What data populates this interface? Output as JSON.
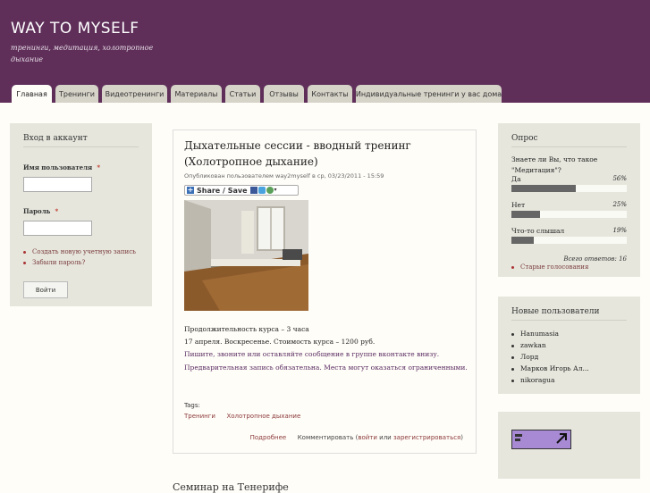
{
  "site": {
    "name": "WAY TO MYSELF",
    "slogan": "тренинги, медитация, холотропное дыхание"
  },
  "nav": {
    "tabs": [
      {
        "label": "Главная",
        "active": true
      },
      {
        "label": "Тренинги"
      },
      {
        "label": "Видеотренинги"
      },
      {
        "label": "Материалы"
      },
      {
        "label": "Статьи"
      },
      {
        "label": "Отзывы"
      },
      {
        "label": "Контакты"
      },
      {
        "label": "Индивидуальные тренинги у вас дома"
      }
    ]
  },
  "login": {
    "title": "Вход в аккаунт",
    "username_label": "Имя пользователя",
    "password_label": "Пароль",
    "required_mark": "*",
    "links": [
      "Создать новую учетную запись",
      "Забыли пароль?"
    ],
    "submit": "Войти"
  },
  "article": {
    "title": "Дыхательные сессии - вводный тренинг (Холотропное дыхание)",
    "meta": "Опубликован пользователем way2myself в ср, 03/23/2011 - 15:59",
    "share_label": "Share / Save",
    "paragraphs": [
      "Продолжительность курса – 3 часа",
      "17 апреля. Воскресенье. Стоимость курса – 1200 руб.",
      "Пишите, звоните или оставляйте сообщение в группе вконтакте внизу.",
      "Предварительная запись обязательна. Места могут оказаться ограниченными."
    ],
    "tags_label": "Tags:",
    "tags": [
      "Тренинги",
      "Холотропное дыхание"
    ],
    "read_more": "Подробнее",
    "comment_prefix": "Комментировать (",
    "comment_login": "войти",
    "comment_or": " или ",
    "comment_register": "зарегистрироваться",
    "comment_suffix": ")"
  },
  "poll": {
    "title": "Опрос",
    "question": "Знаете ли Вы, что такое \"Медитация\"?",
    "options": [
      {
        "label": "Да",
        "percent_label": "56%",
        "percent": 56
      },
      {
        "label": "Нет",
        "percent_label": "25%",
        "percent": 25
      },
      {
        "label": "Что-то слышал",
        "percent_label": "19%",
        "percent": 19
      }
    ],
    "total": "Всего ответов: 16",
    "old_polls": "Старые голосования"
  },
  "new_users": {
    "title": "Новые пользователи",
    "users": [
      "Hanumasia",
      "zawkan",
      "Лорд",
      "Марков Игорь Ал...",
      "nikoragua"
    ]
  },
  "bottom_heading": "Семинар на Тенерифе",
  "colors": {
    "header_bg": "#5f2f5a",
    "link": "#8b3a3a",
    "poll_bar": "#666666",
    "badge": "#a78ad3"
  }
}
